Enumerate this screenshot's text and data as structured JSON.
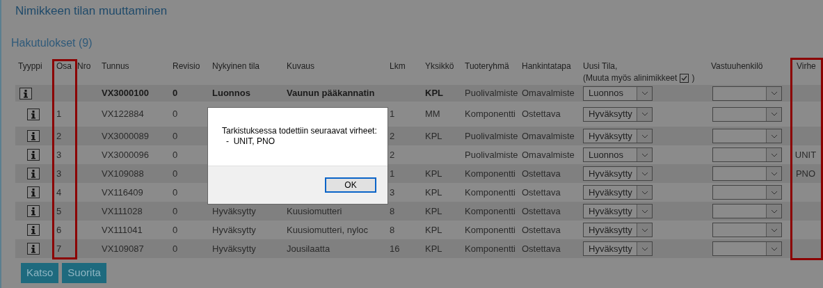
{
  "page_title": "Nimikkeen tilan muuttaminen",
  "results_heading": "Hakutulokset (9)",
  "table": {
    "columns": [
      "Tyyppi",
      "Osa",
      "Nro",
      "Tunnus",
      "Revisio",
      "Nykyinen tila",
      "Kuvaus",
      "Lkm",
      "Yksikkö",
      "Tuoteryhmä",
      "Hankintatapa",
      "Uusi Tila,",
      "Vastuuhenkilö",
      "Virhe"
    ],
    "uusi_tila_note": "(Muuta myös alinimikkeet",
    "uusi_tila_note_end": ")",
    "cascade_checked": true,
    "rows": [
      {
        "kind": "parent",
        "osa": "",
        "tunnus": "VX3000100",
        "revisio": "0",
        "tila": "Luonnos",
        "kuvaus": "Vaunun pääkannatin",
        "lkm": "",
        "yksikko": "KPL",
        "tuoteryhma": "Puolivalmiste",
        "hankintatapa": "Omavalmiste",
        "uusi_tila": "Luonnos",
        "virhe": ""
      },
      {
        "kind": "child",
        "osa": "1",
        "tunnus": "VX122884",
        "revisio": "0",
        "tila": "",
        "kuvaus": "",
        "lkm": "1",
        "yksikko": "MM",
        "tuoteryhma": "Komponentti",
        "hankintatapa": "Ostettava",
        "uusi_tila": "Hyväksytty",
        "virhe": ""
      },
      {
        "kind": "child",
        "osa": "2",
        "tunnus": "VX3000089",
        "revisio": "0",
        "tila": "",
        "kuvaus": "",
        "lkm": "2",
        "yksikko": "KPL",
        "tuoteryhma": "Puolivalmiste",
        "hankintatapa": "Omavalmiste",
        "uusi_tila": "Hyväksytty",
        "virhe": ""
      },
      {
        "kind": "child",
        "osa": "3",
        "tunnus": "VX3000096",
        "revisio": "0",
        "tila": "",
        "kuvaus": "",
        "lkm": "2",
        "yksikko": "",
        "tuoteryhma": "Puolivalmiste",
        "hankintatapa": "Omavalmiste",
        "uusi_tila": "Luonnos",
        "virhe": "UNIT"
      },
      {
        "kind": "child",
        "osa": "3",
        "tunnus": "VX109088",
        "revisio": "0",
        "tila": "",
        "kuvaus": "",
        "lkm": "1",
        "yksikko": "KPL",
        "tuoteryhma": "Komponentti",
        "hankintatapa": "Ostettava",
        "uusi_tila": "Hyväksytty",
        "virhe": "PNO"
      },
      {
        "kind": "child",
        "osa": "4",
        "tunnus": "VX116409",
        "revisio": "0",
        "tila": "",
        "kuvaus": "",
        "lkm": "3",
        "yksikko": "KPL",
        "tuoteryhma": "Komponentti",
        "hankintatapa": "Ostettava",
        "uusi_tila": "Hyväksytty",
        "virhe": ""
      },
      {
        "kind": "child",
        "osa": "5",
        "tunnus": "VX111028",
        "revisio": "0",
        "tila": "Hyväksytty",
        "kuvaus": "Kuusiomutteri",
        "lkm": "8",
        "yksikko": "KPL",
        "tuoteryhma": "Komponentti",
        "hankintatapa": "Ostettava",
        "uusi_tila": "Hyväksytty",
        "virhe": ""
      },
      {
        "kind": "child",
        "osa": "6",
        "tunnus": "VX111041",
        "revisio": "0",
        "tila": "Hyväksytty",
        "kuvaus": "Kuusiomutteri, nyloc",
        "lkm": "8",
        "yksikko": "KPL",
        "tuoteryhma": "Komponentti",
        "hankintatapa": "Ostettava",
        "uusi_tila": "Hyväksytty",
        "virhe": ""
      },
      {
        "kind": "child",
        "osa": "7",
        "tunnus": "VX109087",
        "revisio": "0",
        "tila": "Hyväksytty",
        "kuvaus": "Jousilaatta",
        "lkm": "16",
        "yksikko": "KPL",
        "tuoteryhma": "Komponentti",
        "hankintatapa": "Ostettava",
        "uusi_tila": "Hyväksytty",
        "virhe": ""
      }
    ]
  },
  "buttons": [
    "Katso",
    "Suorita"
  ],
  "dialog": {
    "message": "Tarkistuksessa todettiin seuraavat virheet:",
    "detail": "-  UNIT, PNO",
    "button": "OK"
  }
}
